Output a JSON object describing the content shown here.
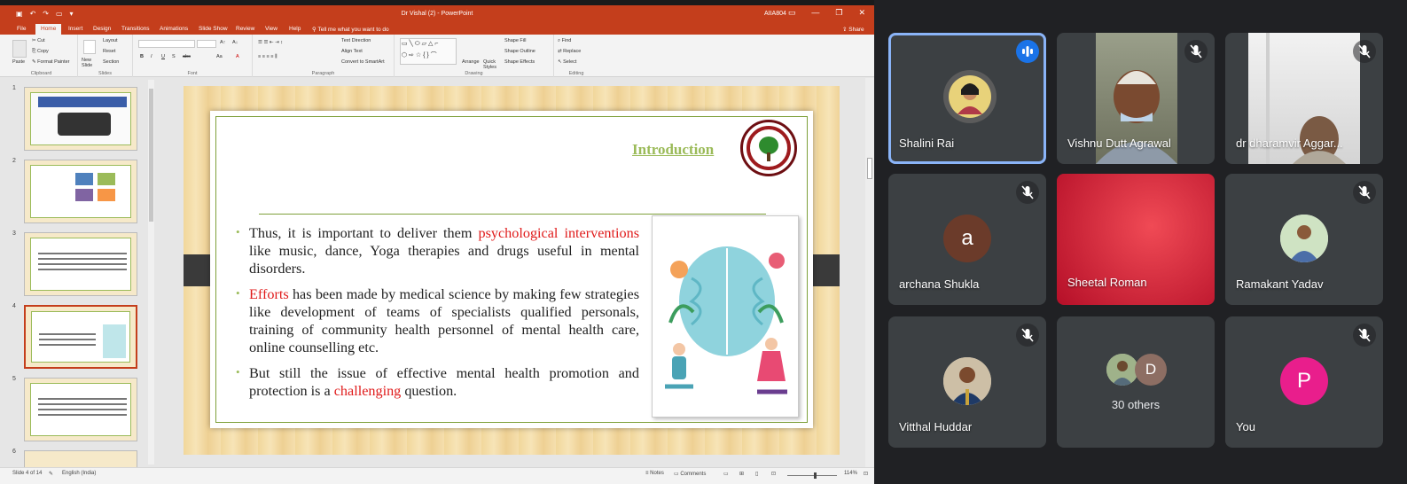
{
  "powerpoint": {
    "window_title": "Dr Vishal (2)  -  PowerPoint",
    "user_label": "AIIA804",
    "share_label": "Share",
    "tabs": [
      "File",
      "Home",
      "Insert",
      "Design",
      "Transitions",
      "Animations",
      "Slide Show",
      "Review",
      "View",
      "Help"
    ],
    "tell_me": "Tell me what you want to do",
    "ribbon": {
      "clipboard": {
        "label": "Clipboard",
        "paste": "Paste",
        "cut": "Cut",
        "copy": "Copy",
        "format_painter": "Format Painter"
      },
      "slides": {
        "label": "Slides",
        "new_slide": "New Slide",
        "layout": "Layout",
        "reset": "Reset",
        "section": "Section"
      },
      "font": {
        "label": "Font",
        "bold": "B",
        "italic": "I",
        "underline": "U",
        "shadow": "S",
        "strike": "abc",
        "aa": "Aa",
        "font_color": "A"
      },
      "paragraph": {
        "label": "Paragraph",
        "text_direction": "Text Direction",
        "align_text": "Align Text",
        "smartart": "Convert to SmartArt"
      },
      "drawing": {
        "label": "Drawing",
        "arrange": "Arrange",
        "quick_styles": "Quick Styles",
        "shape_fill": "Shape Fill",
        "shape_outline": "Shape Outline",
        "shape_effects": "Shape Effects"
      },
      "editing": {
        "label": "Editing",
        "find": "Find",
        "replace": "Replace",
        "select": "Select"
      }
    },
    "thumbnail_numbers": [
      "1",
      "2",
      "3",
      "4",
      "5",
      "6"
    ],
    "slide": {
      "title": "Introduction",
      "bullet1": {
        "pre": "Thus, it is important to deliver them ",
        "highlight": "psychological interventions",
        "post": " like music, dance, Yoga therapies and drugs useful in mental disorders."
      },
      "bullet2": {
        "highlight": "Efforts",
        "post": " has been made by medical science by making few strategies like development of teams of specialists qualified personals, training of community health personnel of mental health care, online counselling etc."
      },
      "bullet3": {
        "pre": "But still the issue of effective mental health promotion and protection is a ",
        "highlight": "challenging",
        "post": " question."
      }
    },
    "status": {
      "slide_of": "Slide 4 of 14",
      "language": "English (India)",
      "notes": "Notes",
      "comments": "Comments",
      "zoom": "114%"
    }
  },
  "meet": {
    "participants": [
      {
        "name": "Shalini Rai"
      },
      {
        "name": "Vishnu Dutt Agrawal"
      },
      {
        "name": "dr dharamvir Aggar..."
      },
      {
        "name": "archana Shukla",
        "initial": "a"
      },
      {
        "name": "Sheetal Roman"
      },
      {
        "name": "Ramakant Yadav"
      },
      {
        "name": "Vitthal Huddar"
      },
      {
        "others_label": "30 others",
        "initial": "D"
      },
      {
        "name": "You",
        "initial": "P"
      }
    ],
    "colors": {
      "tile_bg": "#3c4043",
      "speaking_border": "#8ab4f8",
      "archana_avatar": "#6b3b2a",
      "you_avatar": "#e91e8c",
      "d_avatar": "#8d6e63"
    }
  }
}
